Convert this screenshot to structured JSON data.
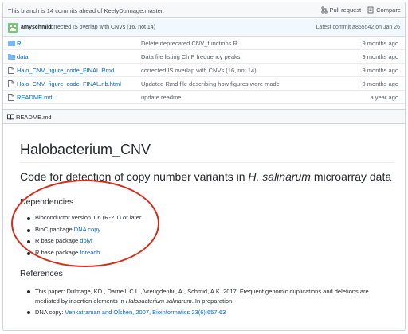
{
  "branch_bar": {
    "status": "This branch is 14 commits ahead of KeelyDulmage:master.",
    "pull_request": "Pull request",
    "compare": "Compare"
  },
  "latest_commit": {
    "author": "amyschmid",
    "message": "corrected IS overlap with CNVs (16, not 14)",
    "meta": "Latest commit a855542 on Jan 26"
  },
  "files": [
    {
      "name": "R",
      "type": "folder",
      "message": "Delete deprecated CNV_functions.R",
      "age": "9 months ago"
    },
    {
      "name": "data",
      "type": "folder",
      "message": "Data file listing ChIP frequency peaks",
      "age": "9 months ago"
    },
    {
      "name": "Halo_CNV_figure_code_FINAL.Rmd",
      "type": "file",
      "message": "corrected IS overlap with CNVs (16, not 14)",
      "age": "9 months ago"
    },
    {
      "name": "Halo_CNV_figure_code_FINAL.nb.html",
      "type": "file",
      "message": "Updated Rmd file describing how figures were made",
      "age": "9 months ago"
    },
    {
      "name": "README.md",
      "type": "file",
      "message": "update readme",
      "age": "a year ago"
    }
  ],
  "readme": {
    "header": "README.md",
    "title": "Halobacterium_CNV",
    "subtitle_pre": "Code for detection of copy number variants in ",
    "subtitle_em": "H. salinarum",
    "subtitle_post": " microarray data",
    "deps_heading": "Dependencies",
    "deps": [
      {
        "text": "Bioconductor version 1.6 (R-2.1) or later",
        "link": ""
      },
      {
        "text": "BioC package ",
        "link": "DNA copy"
      },
      {
        "text": "R base package ",
        "link": "dplyr"
      },
      {
        "text": "R base package ",
        "link": "foreach"
      }
    ],
    "refs_heading": "References",
    "ref1_pre": "This paper: Dulmage, KD., Darnell, C.L., Vreugdenhil, A., Schmid, A.K. 2017. Frequent genomic duplications and deletions are mediated by insertion elements in ",
    "ref1_em": "Halobacterium salinarum",
    "ref1_post": ". In preparation.",
    "ref2_pre": "DNA copy: ",
    "ref2_link": "Venkatraman and Olshen, 2007, Bioinformatics 23(6):657-63"
  },
  "colors": {
    "annotation": "#d62c1a",
    "link": "#0366d6",
    "folder": "#79b8ff"
  }
}
